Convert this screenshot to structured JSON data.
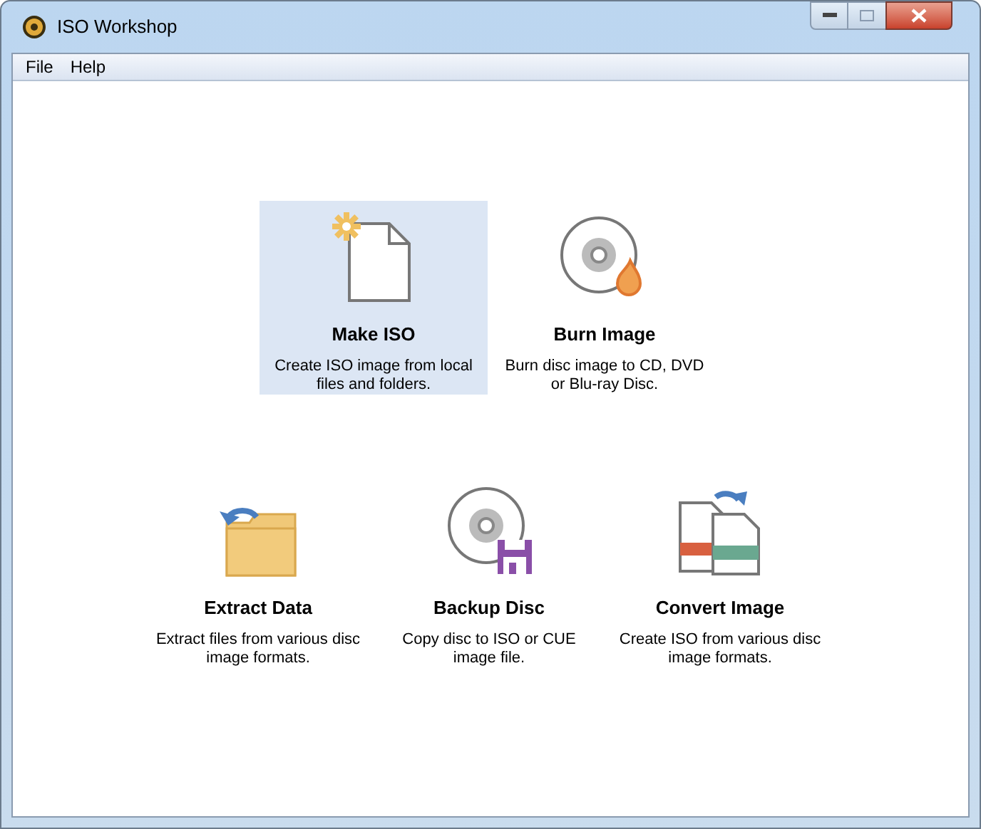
{
  "window": {
    "title": "ISO Workshop"
  },
  "menu": [
    "File",
    "Help"
  ],
  "rows": [
    [
      {
        "kind": "make",
        "title": "Make ISO",
        "description": "Create ISO image from local files and folders.",
        "selected": true
      },
      {
        "kind": "burn",
        "title": "Burn Image",
        "description": "Burn disc image to CD, DVD or Blu-ray Disc.",
        "selected": false
      }
    ],
    [
      {
        "kind": "extract",
        "title": "Extract Data",
        "description": "Extract files from various disc image formats.",
        "selected": false
      },
      {
        "kind": "backup",
        "title": "Backup Disc",
        "description": "Copy disc to ISO or CUE image file.",
        "selected": false
      },
      {
        "kind": "convert",
        "title": "Convert Image",
        "description": "Create ISO from various disc image formats.",
        "selected": false
      }
    ]
  ]
}
